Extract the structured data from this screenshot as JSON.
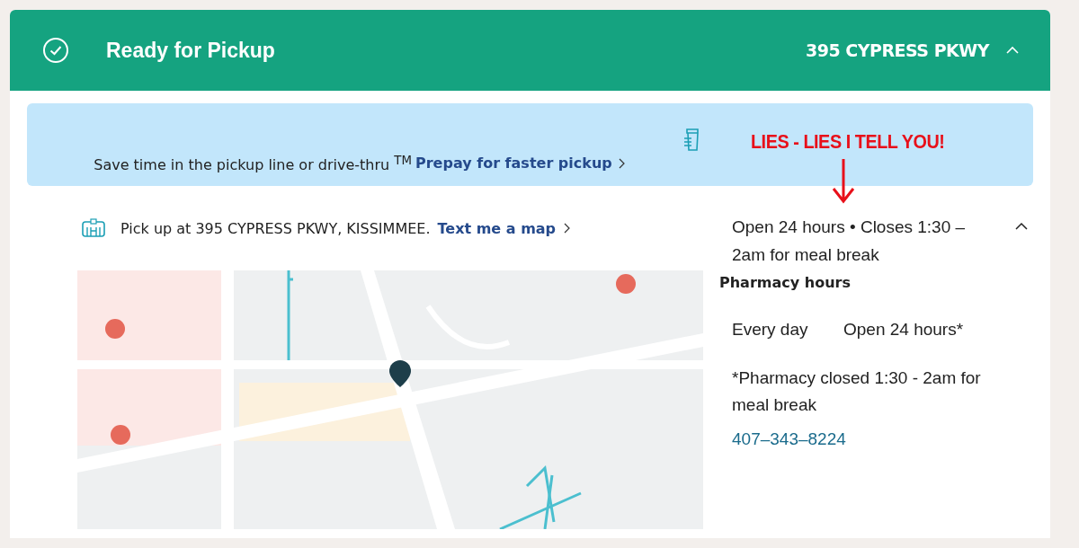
{
  "header": {
    "status": "Ready for Pickup",
    "store": "395 CYPRESS PKWY",
    "expanded": true
  },
  "banner": {
    "text": "Save time in the pickup line or drive-thru $^{TM}$",
    "link": "Prepay for faster pickup"
  },
  "annotation": {
    "text": "LIES - LIES I TELL YOU!"
  },
  "pickup": {
    "text": "Pick up at 395 CYPRESS PKWY, KISSIMMEE.",
    "link": "Text me a map"
  },
  "hours": {
    "summary": "Open 24 hours • Closes 1:30 – 2am for meal break",
    "expanded": true,
    "title": "Pharmacy hours",
    "rows": [
      {
        "day": "Every day",
        "time": "Open 24 hours*"
      }
    ],
    "note": "*Pharmacy closed 1:30 - 2am for meal break",
    "phone": "407–343–8224"
  }
}
